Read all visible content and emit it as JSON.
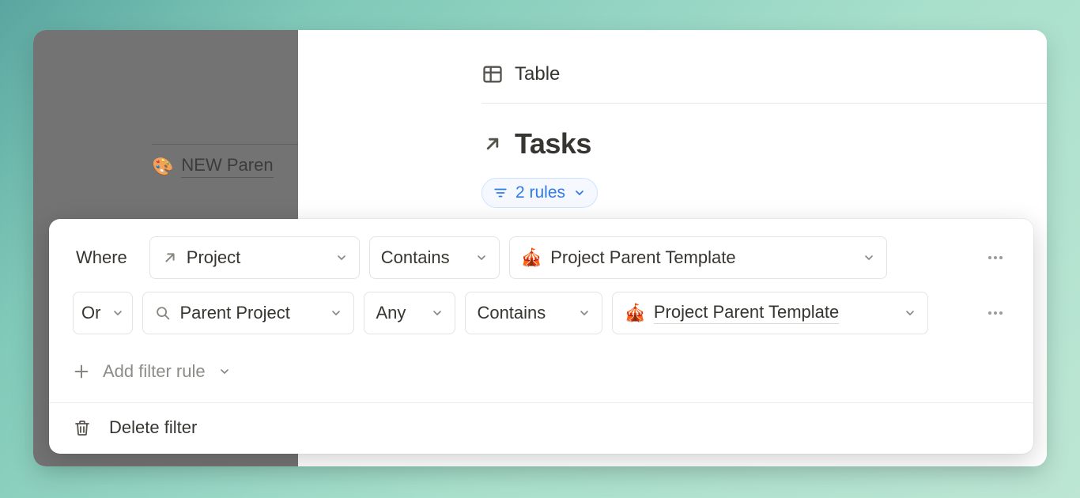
{
  "left": {
    "item_emoji": "🎨",
    "item_label": "NEW Paren"
  },
  "view": {
    "tab_label": "Table",
    "title": "Tasks",
    "rules_chip_label": "2 rules"
  },
  "filter": {
    "rules": [
      {
        "prefix": "Where",
        "field": "Project",
        "condition": "Contains",
        "value_emoji": "🎪",
        "value": "Project Parent Template"
      },
      {
        "conjunction": "Or",
        "field": "Parent Project",
        "rollup": "Any",
        "condition": "Contains",
        "value_emoji": "🎪",
        "value": "Project Parent Template"
      }
    ],
    "add_label": "Add filter rule",
    "delete_label": "Delete filter"
  }
}
